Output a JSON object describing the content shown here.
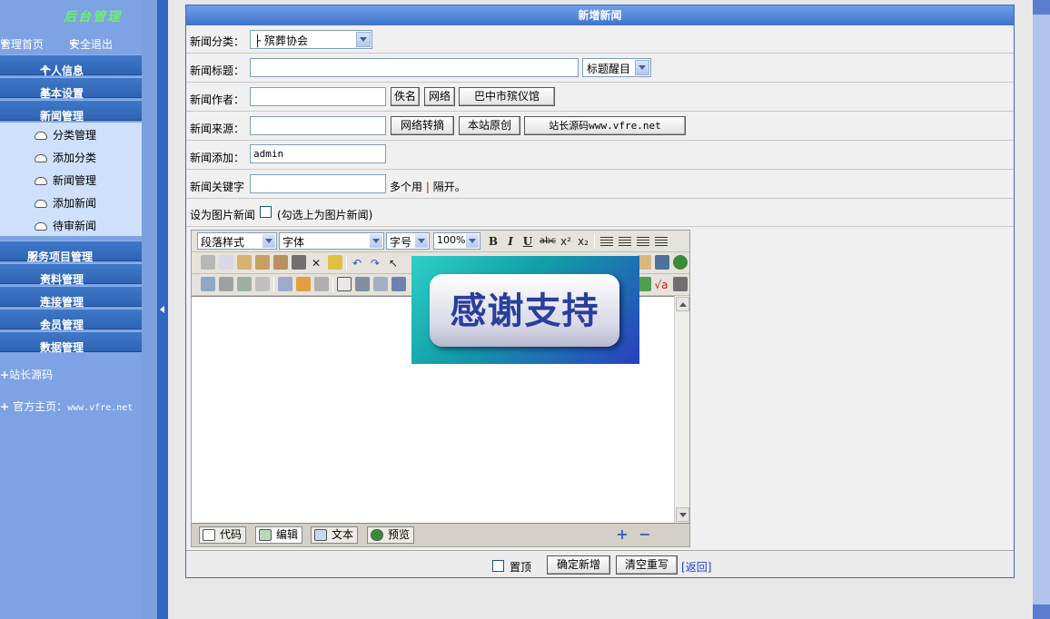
{
  "sidebar": {
    "logo": "后台管理",
    "top_links": [
      "管理首页",
      "安全退出"
    ],
    "menus": [
      {
        "label": "个人信息"
      },
      {
        "label": "基本设置"
      },
      {
        "label": "新闻管理"
      },
      {
        "label": "服务项目管理"
      },
      {
        "label": "资料管理"
      },
      {
        "label": "连接管理"
      },
      {
        "label": "会员管理"
      },
      {
        "label": "数据管理"
      }
    ],
    "news_sub": [
      "分类管理",
      "添加分类",
      "新闻管理",
      "添加新闻",
      "待审新闻"
    ],
    "site_source": "站长源码",
    "official_label": "官方主页：",
    "official_url": "www.vfre.net"
  },
  "form": {
    "title": "新增新闻",
    "category_label": "新闻分类：",
    "category_value": "├ 殡葬协会",
    "title_label": "新闻标题：",
    "title_value": "",
    "title_style_value": "标题醒目",
    "author_label": "新闻作者：",
    "author_value": "",
    "author_buttons": [
      "佚名",
      "网络",
      "巴中市殡仪馆"
    ],
    "source_label": "新闻来源：",
    "source_value": "",
    "source_buttons": [
      "网络转摘",
      "本站原创",
      "站长源码www.vfre.net"
    ],
    "adder_label": "新闻添加：",
    "adder_value": "admin",
    "keyword_label": "新闻关键字",
    "keyword_value": "",
    "keyword_hint_pre": "多个用",
    "keyword_hint_sep": "|",
    "keyword_hint_post": "隔开。",
    "image_news_label": "设为图片新闻",
    "image_news_hint": "(勾选上为图片新闻)",
    "pin_label": "置顶",
    "submit_label": "确定新增",
    "reset_label": "清空重写",
    "back_open": "[",
    "back_label": "返回",
    "back_close": "]"
  },
  "editor": {
    "paragraph_style": "段落样式",
    "font_family": "字体",
    "font_size": "字号",
    "zoom": "100%",
    "bold": "B",
    "italic": "I",
    "underline": "U",
    "strike": "abc",
    "sup": "x²",
    "sub": "x₂",
    "modes": [
      "代码",
      "编辑",
      "文本",
      "预览"
    ],
    "zoom_in": "+",
    "zoom_out": "−"
  },
  "overlay": {
    "text": "感谢支持"
  }
}
